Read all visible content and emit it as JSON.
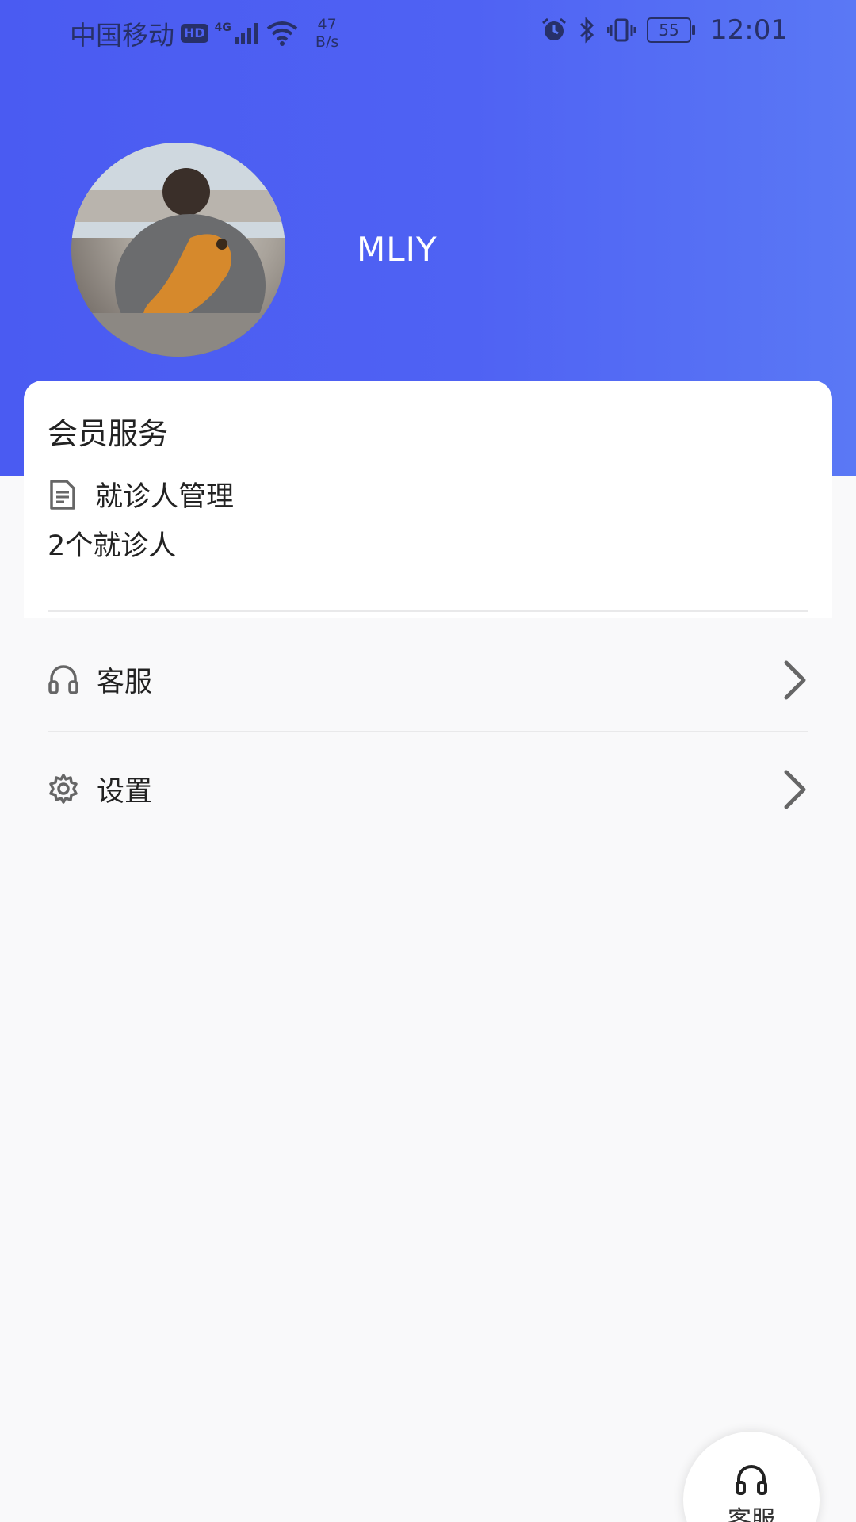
{
  "status_bar": {
    "carrier": "中国移动",
    "hd_badge": "HD",
    "net_type": "4G",
    "net_speed_value": "47",
    "net_speed_unit": "B/s",
    "battery": "55",
    "time": "12:01"
  },
  "profile": {
    "username": "MLIY"
  },
  "member_card": {
    "title": "会员服务",
    "manage_label": "就诊人管理",
    "patient_count": "2个就诊人"
  },
  "menu": {
    "service_label": "客服",
    "settings_label": "设置"
  },
  "fab": {
    "label": "客服"
  },
  "colors": {
    "header_start": "#4a5bf2",
    "header_end": "#5a78f5",
    "page_bg": "#f9f9fa"
  }
}
